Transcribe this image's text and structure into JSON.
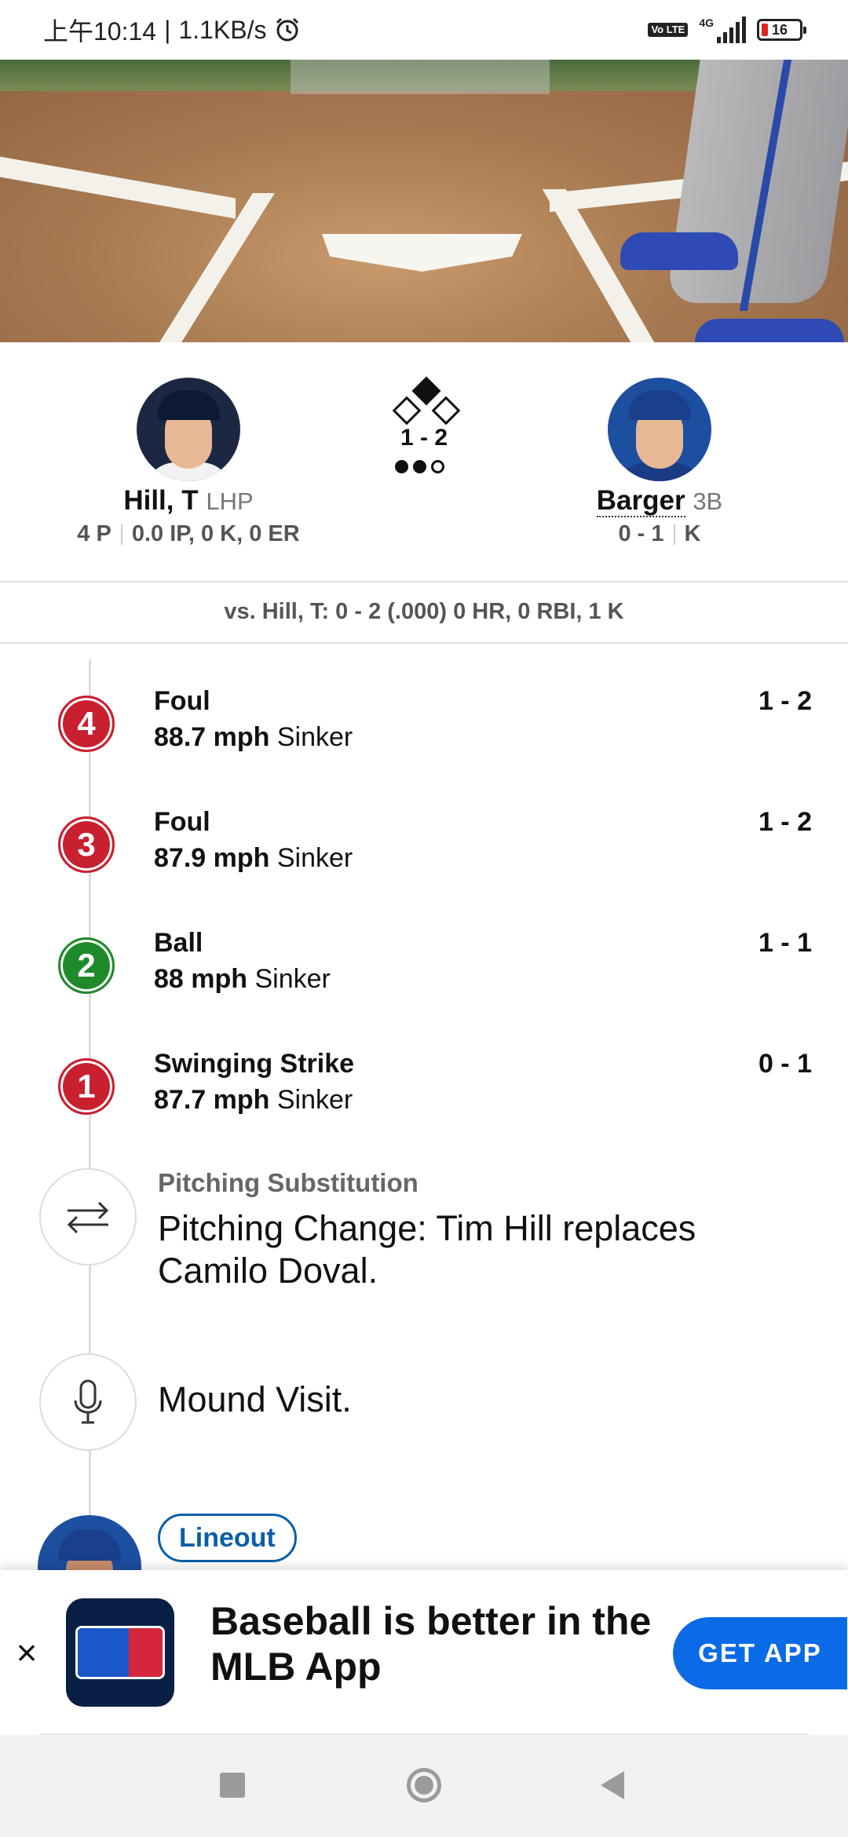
{
  "status_bar": {
    "time": "上午10:14",
    "speed": "1.1KB/s",
    "network": "4G",
    "volte": "Vo LTE",
    "battery": "16"
  },
  "matchup": {
    "pitcher": {
      "name": "Hill, T",
      "position": "LHP",
      "pitches": "4 P",
      "line": "0.0 IP, 0 K, 0 ER"
    },
    "batter": {
      "name": "Barger",
      "position": "3B",
      "hits": "0 - 1",
      "result": "K"
    },
    "count": "1 - 2",
    "outs": [
      true,
      true,
      false
    ],
    "bases": {
      "first": false,
      "second": true,
      "third": false
    }
  },
  "vs_line": "vs. Hill, T: 0 - 2 (.000) 0 HR, 0 RBI, 1 K",
  "pitches": [
    {
      "number": "4",
      "result": "Foul",
      "speed": "88.7 mph",
      "type": "Sinker",
      "count": "1 - 2",
      "color": "#c9202f"
    },
    {
      "number": "3",
      "result": "Foul",
      "speed": "87.9 mph",
      "type": "Sinker",
      "count": "1 - 2",
      "color": "#c9202f"
    },
    {
      "number": "2",
      "result": "Ball",
      "speed": "88 mph",
      "type": "Sinker",
      "count": "1 - 1",
      "color": "#1e8a2a"
    },
    {
      "number": "1",
      "result": "Swinging Strike",
      "speed": "87.7 mph",
      "type": "Sinker",
      "count": "0 - 1",
      "color": "#c9202f"
    }
  ],
  "substitution": {
    "title": "Pitching Substitution",
    "text": "Pitching Change: Tim Hill replaces Camilo Doval.",
    "icon": "swap-arrows-icon"
  },
  "mound_visit": {
    "text": "Mound Visit.",
    "icon": "microphone-icon"
  },
  "next_play": {
    "label": "Lineout"
  },
  "app_banner": {
    "close": "×",
    "text": "Baseball is better in the MLB App",
    "button": "GET APP"
  },
  "colors": {
    "accent_blue": "#0b6be6",
    "strike_red": "#c9202f",
    "ball_green": "#1e8a2a",
    "link_blue": "#0b5ea8"
  }
}
